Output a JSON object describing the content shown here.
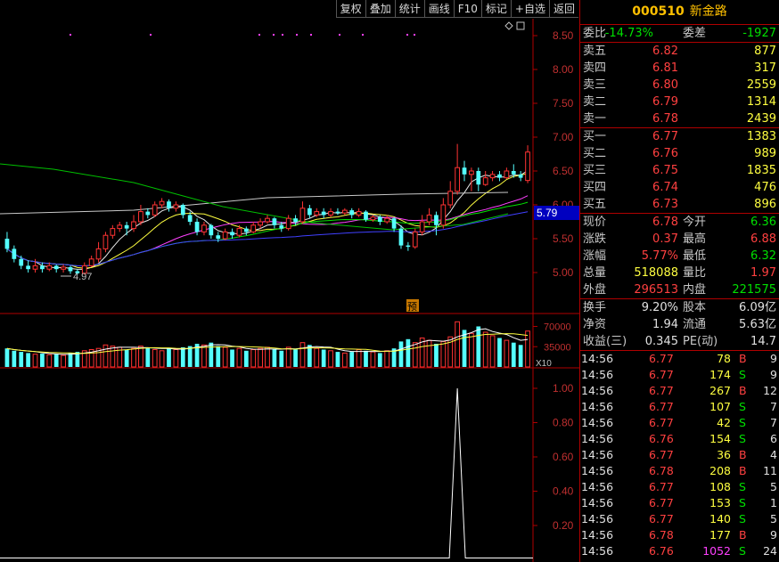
{
  "toolbar": [
    "复权",
    "叠加",
    "统计",
    "画线",
    "F10",
    "标记",
    "+自选",
    "返回"
  ],
  "stock": {
    "code": "000510",
    "name": "新金路"
  },
  "weibi": {
    "label": "委比",
    "value": "-14.73%",
    "label2": "委差",
    "value2": "-1927"
  },
  "asks": [
    {
      "label": "卖五",
      "price": "6.82",
      "vol": "877"
    },
    {
      "label": "卖四",
      "price": "6.81",
      "vol": "317"
    },
    {
      "label": "卖三",
      "price": "6.80",
      "vol": "2559"
    },
    {
      "label": "卖二",
      "price": "6.79",
      "vol": "1314"
    },
    {
      "label": "卖一",
      "price": "6.78",
      "vol": "2439"
    }
  ],
  "bids": [
    {
      "label": "买一",
      "price": "6.77",
      "vol": "1383"
    },
    {
      "label": "买二",
      "price": "6.76",
      "vol": "989"
    },
    {
      "label": "买三",
      "price": "6.75",
      "vol": "1835"
    },
    {
      "label": "买四",
      "price": "6.74",
      "vol": "476"
    },
    {
      "label": "买五",
      "price": "6.73",
      "vol": "896"
    }
  ],
  "quote": [
    {
      "l1": "现价",
      "v1": "6.78",
      "c1": "red",
      "l2": "今开",
      "v2": "6.36",
      "c2": "green"
    },
    {
      "l1": "涨跌",
      "v1": "0.37",
      "c1": "red",
      "l2": "最高",
      "v2": "6.88",
      "c2": "red"
    },
    {
      "l1": "涨幅",
      "v1": "5.77%",
      "c1": "red",
      "l2": "最低",
      "v2": "6.32",
      "c2": "green"
    },
    {
      "l1": "总量",
      "v1": "518088",
      "c1": "yellow",
      "l2": "量比",
      "v2": "1.97",
      "c2": "red"
    },
    {
      "l1": "外盘",
      "v1": "296513",
      "c1": "red",
      "l2": "内盘",
      "v2": "221575",
      "c2": "green"
    }
  ],
  "fund": [
    {
      "l1": "换手",
      "v1": "9.20%",
      "l2": "股本",
      "v2": "6.09亿"
    },
    {
      "l1": "净资",
      "v1": "1.94",
      "l2": "流通",
      "v2": "5.63亿"
    },
    {
      "l1": "收益(三)",
      "v1": "0.345",
      "l2": "PE(动)",
      "v2": "14.7"
    }
  ],
  "deals": [
    {
      "t": "14:56",
      "p": "6.77",
      "v": "78",
      "bs": "B",
      "n": "9"
    },
    {
      "t": "14:56",
      "p": "6.77",
      "v": "174",
      "bs": "S",
      "n": "9"
    },
    {
      "t": "14:56",
      "p": "6.77",
      "v": "267",
      "bs": "B",
      "n": "12"
    },
    {
      "t": "14:56",
      "p": "6.77",
      "v": "107",
      "bs": "S",
      "n": "7"
    },
    {
      "t": "14:56",
      "p": "6.77",
      "v": "42",
      "bs": "S",
      "n": "7"
    },
    {
      "t": "14:56",
      "p": "6.76",
      "v": "154",
      "bs": "S",
      "n": "6"
    },
    {
      "t": "14:56",
      "p": "6.77",
      "v": "36",
      "bs": "B",
      "n": "4"
    },
    {
      "t": "14:56",
      "p": "6.78",
      "v": "208",
      "bs": "B",
      "n": "11"
    },
    {
      "t": "14:56",
      "p": "6.77",
      "v": "108",
      "bs": "S",
      "n": "5"
    },
    {
      "t": "14:56",
      "p": "6.77",
      "v": "153",
      "bs": "S",
      "n": "1"
    },
    {
      "t": "14:56",
      "p": "6.77",
      "v": "140",
      "bs": "S",
      "n": "5"
    },
    {
      "t": "14:56",
      "p": "6.78",
      "v": "177",
      "bs": "B",
      "n": "9"
    },
    {
      "t": "14:56",
      "p": "6.76",
      "v": "1052",
      "bs": "S",
      "n": "24"
    }
  ],
  "chart_data": {
    "type": "candlestick",
    "price_ticks": [
      "8.50",
      "8.00",
      "7.50",
      "7.00",
      "6.50",
      "6.00",
      "5.50",
      "5.00"
    ],
    "price_range": [
      4.7,
      8.7
    ],
    "low_label": "4.97",
    "current_price_label": "5.79",
    "yu_marker": "预",
    "vol_ticks": [
      "70000",
      "35000"
    ],
    "vol_unit": "X10",
    "vol_max": 80000,
    "ind_ticks": [
      "1.00",
      "0.80",
      "0.60",
      "0.40",
      "0.20"
    ],
    "candles": [
      [
        5.5,
        5.35,
        5.6,
        5.3
      ],
      [
        5.35,
        5.2,
        5.4,
        5.15
      ],
      [
        5.2,
        5.1,
        5.25,
        5.05
      ],
      [
        5.1,
        5.05,
        5.18,
        5.0
      ],
      [
        5.05,
        5.1,
        5.2,
        5.0
      ],
      [
        5.1,
        5.05,
        5.15,
        5.0
      ],
      [
        5.05,
        5.1,
        5.15,
        5.02
      ],
      [
        5.1,
        5.05,
        5.12,
        5.0
      ],
      [
        5.05,
        5.08,
        5.12,
        5.0
      ],
      [
        5.08,
        5.02,
        5.1,
        4.98
      ],
      [
        5.02,
        4.99,
        5.05,
        4.97
      ],
      [
        4.99,
        5.1,
        5.15,
        4.97
      ],
      [
        5.1,
        5.2,
        5.25,
        5.08
      ],
      [
        5.2,
        5.35,
        5.45,
        5.15
      ],
      [
        5.35,
        5.55,
        5.6,
        5.3
      ],
      [
        5.55,
        5.65,
        5.7,
        5.5
      ],
      [
        5.65,
        5.7,
        5.75,
        5.6
      ],
      [
        5.7,
        5.65,
        5.75,
        5.55
      ],
      [
        5.65,
        5.75,
        5.85,
        5.6
      ],
      [
        5.75,
        5.9,
        6.0,
        5.7
      ],
      [
        5.9,
        5.85,
        5.95,
        5.8
      ],
      [
        5.85,
        6.0,
        6.05,
        5.82
      ],
      [
        6.0,
        6.05,
        6.1,
        5.95
      ],
      [
        6.05,
        5.95,
        6.08,
        5.9
      ],
      [
        5.95,
        6.0,
        6.05,
        5.9
      ],
      [
        6.0,
        5.85,
        6.02,
        5.8
      ],
      [
        5.85,
        5.75,
        5.9,
        5.7
      ],
      [
        5.75,
        5.6,
        5.8,
        5.55
      ],
      [
        5.6,
        5.7,
        5.75,
        5.55
      ],
      [
        5.7,
        5.55,
        5.72,
        5.5
      ],
      [
        5.55,
        5.5,
        5.6,
        5.45
      ],
      [
        5.5,
        5.6,
        5.65,
        5.48
      ],
      [
        5.6,
        5.55,
        5.65,
        5.5
      ],
      [
        5.55,
        5.65,
        5.7,
        5.52
      ],
      [
        5.65,
        5.6,
        5.68,
        5.55
      ],
      [
        5.6,
        5.7,
        5.75,
        5.58
      ],
      [
        5.7,
        5.75,
        5.8,
        5.65
      ],
      [
        5.75,
        5.8,
        5.85,
        5.72
      ],
      [
        5.8,
        5.7,
        5.82,
        5.65
      ],
      [
        5.7,
        5.65,
        5.75,
        5.6
      ],
      [
        5.65,
        5.8,
        5.85,
        5.62
      ],
      [
        5.8,
        5.75,
        5.85,
        5.7
      ],
      [
        5.75,
        5.95,
        6.05,
        5.72
      ],
      [
        5.95,
        5.85,
        6.0,
        5.8
      ],
      [
        5.85,
        5.9,
        5.95,
        5.82
      ],
      [
        5.9,
        5.85,
        5.95,
        5.8
      ],
      [
        5.85,
        5.9,
        5.95,
        5.82
      ],
      [
        5.9,
        5.88,
        5.95,
        5.85
      ],
      [
        5.88,
        5.92,
        5.95,
        5.85
      ],
      [
        5.92,
        5.85,
        5.95,
        5.8
      ],
      [
        5.85,
        5.9,
        5.95,
        5.82
      ],
      [
        5.9,
        5.78,
        5.92,
        5.75
      ],
      [
        5.78,
        5.82,
        5.85,
        5.75
      ],
      [
        5.82,
        5.75,
        5.85,
        5.7
      ],
      [
        5.75,
        5.8,
        5.85,
        5.72
      ],
      [
        5.8,
        5.65,
        5.82,
        5.6
      ],
      [
        5.65,
        5.4,
        5.7,
        5.35
      ],
      [
        5.4,
        5.38,
        5.45,
        5.32
      ],
      [
        5.38,
        5.6,
        5.65,
        5.35
      ],
      [
        5.6,
        5.75,
        5.85,
        5.55
      ],
      [
        5.75,
        5.85,
        5.95,
        5.7
      ],
      [
        5.85,
        5.7,
        5.9,
        5.55
      ],
      [
        5.7,
        6.0,
        6.1,
        5.65
      ],
      [
        6.0,
        6.2,
        6.35,
        5.95
      ],
      [
        6.2,
        6.55,
        6.9,
        6.15
      ],
      [
        6.55,
        6.45,
        6.65,
        6.35
      ],
      [
        6.45,
        6.5,
        6.55,
        6.2
      ],
      [
        6.5,
        6.3,
        6.55,
        6.2
      ],
      [
        6.3,
        6.4,
        6.5,
        6.28
      ],
      [
        6.4,
        6.45,
        6.5,
        6.35
      ],
      [
        6.45,
        6.4,
        6.5,
        6.35
      ],
      [
        6.4,
        6.5,
        6.55,
        6.38
      ],
      [
        6.5,
        6.45,
        6.6,
        6.4
      ],
      [
        6.45,
        6.4,
        6.5,
        6.35
      ],
      [
        6.36,
        6.78,
        6.88,
        6.32
      ]
    ],
    "volumes": [
      32000,
      28000,
      26000,
      24000,
      22000,
      23000,
      21000,
      22000,
      20000,
      24000,
      26000,
      28000,
      30000,
      32000,
      38000,
      36000,
      34000,
      30000,
      32000,
      36000,
      34000,
      30000,
      28000,
      32000,
      30000,
      34000,
      36000,
      40000,
      38000,
      42000,
      36000,
      34000,
      30000,
      32000,
      28000,
      30000,
      32000,
      34000,
      30000,
      28000,
      34000,
      30000,
      42000,
      38000,
      32000,
      30000,
      28000,
      26000,
      24000,
      26000,
      30000,
      28000,
      26000,
      24000,
      28000,
      32000,
      44000,
      48000,
      42000,
      50000,
      46000,
      40000,
      44000,
      52000,
      78000,
      64000,
      58000,
      70000,
      60000,
      54000,
      50000,
      46000,
      42000,
      38000,
      62000
    ],
    "indicator_spike": {
      "index": 64,
      "value": 1.0
    }
  }
}
